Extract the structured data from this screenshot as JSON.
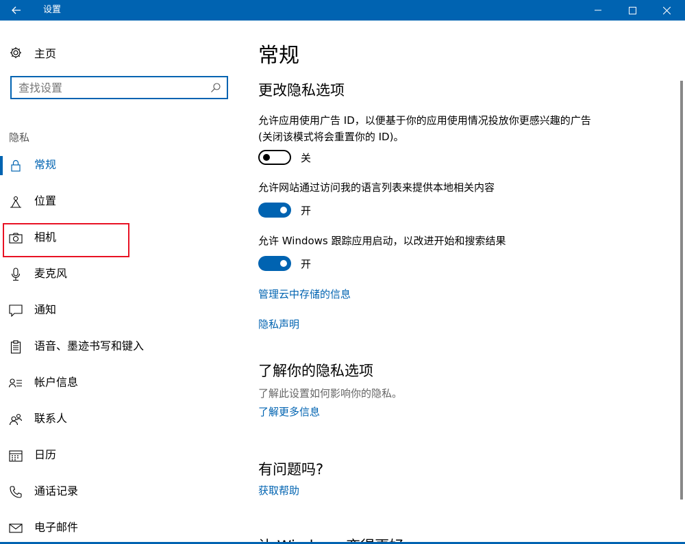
{
  "window": {
    "title": "设置"
  },
  "sidebar": {
    "home_label": "主页",
    "search_placeholder": "查找设置",
    "section_label": "隐私",
    "items": [
      {
        "label": "常规",
        "icon": "lock-icon",
        "active": true
      },
      {
        "label": "位置",
        "icon": "location-icon"
      },
      {
        "label": "相机",
        "icon": "camera-icon",
        "highlighted": true
      },
      {
        "label": "麦克风",
        "icon": "microphone-icon"
      },
      {
        "label": "通知",
        "icon": "notification-icon"
      },
      {
        "label": "语音、墨迹书写和键入",
        "icon": "clipboard-icon"
      },
      {
        "label": "帐户信息",
        "icon": "account-info-icon"
      },
      {
        "label": "联系人",
        "icon": "contacts-icon"
      },
      {
        "label": "日历",
        "icon": "calendar-icon"
      },
      {
        "label": "通话记录",
        "icon": "call-history-icon"
      },
      {
        "label": "电子邮件",
        "icon": "email-icon"
      }
    ]
  },
  "main": {
    "page_title": "常规",
    "section_title": "更改隐私选项",
    "options": [
      {
        "text": "允许应用使用广告 ID，以便基于你的应用使用情况投放你更感兴趣的广告(关闭该模式将会重置你的 ID)。",
        "state_label": "关",
        "on": false
      },
      {
        "text": "允许网站通过访问我的语言列表来提供本地相关内容",
        "state_label": "开",
        "on": true
      },
      {
        "text": "允许 Windows 跟踪应用启动，以改进开始和搜索结果",
        "state_label": "开",
        "on": true
      }
    ],
    "links": {
      "manage_cloud": "管理云中存储的信息",
      "privacy_statement": "隐私声明"
    },
    "learn": {
      "title": "了解你的隐私选项",
      "desc": "了解此设置如何影响你的隐私。",
      "link": "了解更多信息"
    },
    "help": {
      "title": "有问题吗?",
      "link": "获取帮助"
    },
    "improve_title": "让 Windows 变得更好"
  },
  "colors": {
    "accent": "#0063b1",
    "highlight_border": "#e81123"
  }
}
